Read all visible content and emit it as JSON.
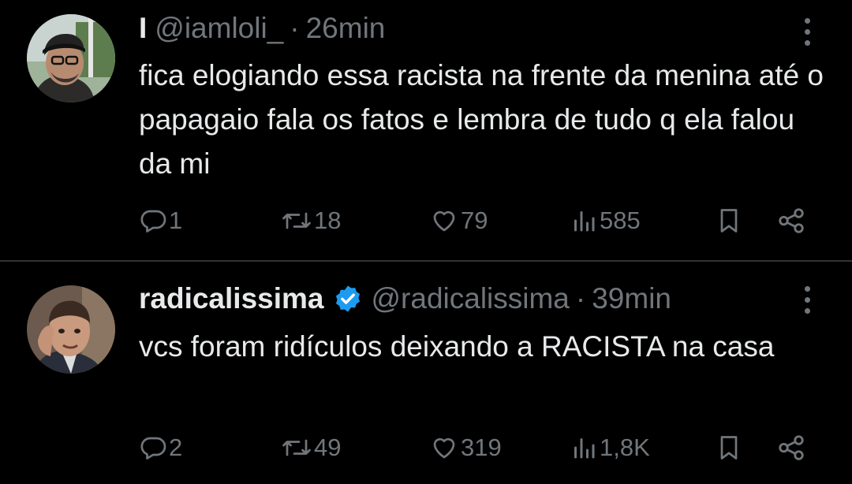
{
  "tweets": [
    {
      "display_name": "I",
      "handle": "@iamloli_",
      "separator": "·",
      "time": "26min",
      "verified": false,
      "text": "fica elogiando essa racista na frente da menina até o papagaio fala os fatos e lembra de tudo q ela falou da mi",
      "replies": "1",
      "retweets": "18",
      "likes": "79",
      "views": "585"
    },
    {
      "display_name": "radicalissima",
      "handle": "@radicalissima",
      "separator": "·",
      "time": "39min",
      "verified": true,
      "text": "vcs foram ridículos deixando a RACISTA na casa",
      "replies": "2",
      "retweets": "49",
      "likes": "319",
      "views": "1,8K"
    }
  ],
  "icons": {
    "reply": "reply-icon",
    "retweet": "retweet-icon",
    "like": "heart-icon",
    "views": "views-icon",
    "bookmark": "bookmark-icon",
    "share": "share-icon",
    "more": "more-icon",
    "verified": "verified-badge-icon"
  },
  "colors": {
    "background": "#000000",
    "text": "#e7e9ea",
    "secondary_text": "#71767b",
    "divider": "#2f3336",
    "verified_blue": "#1d9bf0"
  }
}
